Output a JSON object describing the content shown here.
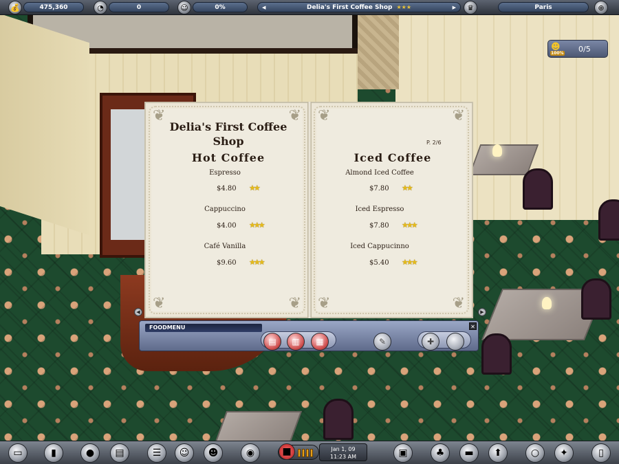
{
  "hud": {
    "money": "475,360",
    "reputation": "0",
    "satisfaction": "0%",
    "restaurant_name": "Delia's First Coffee Shop",
    "city": "Paris"
  },
  "guests": {
    "mood": "100%",
    "count": "0/5"
  },
  "menu": {
    "shop_title": "Delia's First Coffee Shop",
    "page_indicator": "P. 2/6",
    "sections": [
      {
        "title": "Hot Coffee",
        "items": [
          {
            "name": "Espresso",
            "price": "$4.80",
            "stars": 2
          },
          {
            "name": "Cappuccino",
            "price": "$4.00",
            "stars": 3
          },
          {
            "name": "Café Vanilla",
            "price": "$9.60",
            "stars": 3
          }
        ]
      },
      {
        "title": "Iced Coffee",
        "items": [
          {
            "name": "Almond Iced Coffee",
            "price": "$7.80",
            "stars": 2
          },
          {
            "name": "Iced Espresso",
            "price": "$7.80",
            "stars": 3
          },
          {
            "name": "Iced Cappucinno",
            "price": "$5.40",
            "stars": 3
          }
        ]
      }
    ]
  },
  "foodmenu": {
    "title": "FOODMENU",
    "close_glyph": "✕"
  },
  "clock": {
    "date": "Jan 1, 09",
    "time": "11:23 AM"
  },
  "icons": {
    "money": "coin-icon",
    "reputation": "pie-icon",
    "satisfaction": "chef-icon",
    "city": "globe-icon"
  },
  "colors": {
    "star": "#e6bb1a",
    "hud_pill": "#34455f",
    "page": "#efebdf"
  }
}
